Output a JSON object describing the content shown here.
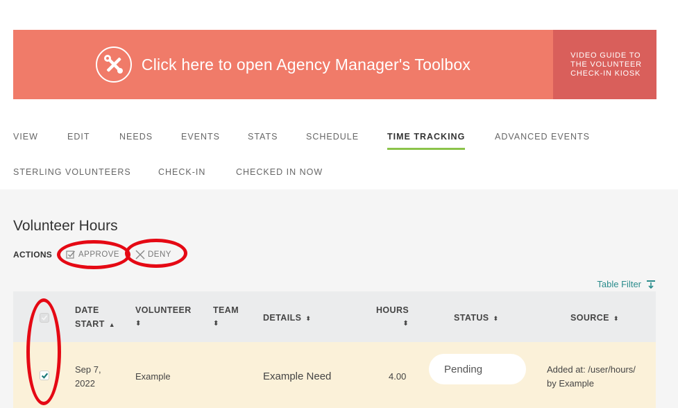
{
  "banner": {
    "main_text": "Click here to open Agency Manager's Toolbox",
    "side_line1": "VIDEO GUIDE TO",
    "side_line2": "THE VOLUNTEER",
    "side_line3": "CHECK-IN KIOSK",
    "icon": "tools-icon",
    "main_color": "#f07b69",
    "side_color": "#d95f5b"
  },
  "nav": {
    "row1": [
      {
        "label": "VIEW"
      },
      {
        "label": "EDIT"
      },
      {
        "label": "NEEDS"
      },
      {
        "label": "EVENTS"
      },
      {
        "label": "STATS"
      },
      {
        "label": "SCHEDULE"
      },
      {
        "label": "TIME TRACKING",
        "active": true
      },
      {
        "label": "ADVANCED EVENTS"
      }
    ],
    "row2": [
      {
        "label": "STERLING VOLUNTEERS"
      },
      {
        "label": "CHECK-IN"
      },
      {
        "label": "CHECKED IN NOW"
      }
    ],
    "active_color": "#8bc34a"
  },
  "page": {
    "title": "Volunteer Hours",
    "actions_label": "ACTIONS",
    "approve_label": "APPROVE",
    "deny_label": "DENY",
    "table_filter_label": "Table Filter"
  },
  "table": {
    "headers": {
      "date_line1": "DATE",
      "date_line2": "START",
      "volunteer": "VOLUNTEER",
      "team": "TEAM",
      "details": "DETAILS",
      "hours": "HOURS",
      "status": "STATUS",
      "source": "SOURCE"
    },
    "rows": [
      {
        "checked": true,
        "date_line1": "Sep 7,",
        "date_line2": "2022",
        "volunteer": "Example",
        "team": "",
        "details": "Example Need",
        "hours": "4.00",
        "status": "Pending",
        "source_line1": "Added at: /user/hours/",
        "source_line2": "by Example"
      }
    ],
    "row_highlight_color": "#fbf1d9"
  },
  "annotation_color": "#e50914"
}
